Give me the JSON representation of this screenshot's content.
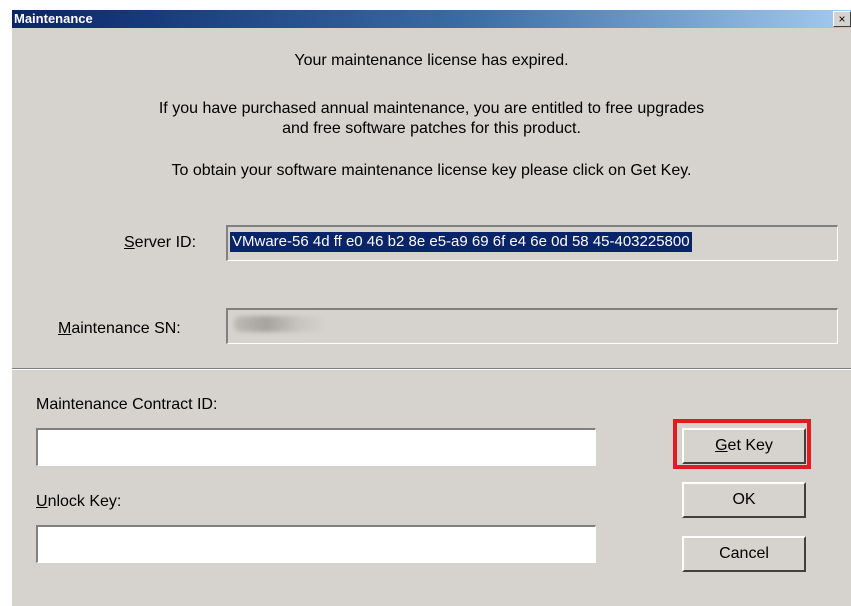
{
  "window": {
    "title": "Maintenance",
    "close_glyph": "×"
  },
  "message": {
    "line1": "Your maintenance license has expired.",
    "line2": "If you have purchased annual maintenance, you are entitled to free upgrades",
    "line3": "and free software patches for this product.",
    "line4": "To obtain your software maintenance license key please click on Get Key."
  },
  "server_id": {
    "label_accel": "S",
    "label_rest": "erver ID:",
    "value": "VMware-56 4d ff e0 46 b2 8e e5-a9 69 6f e4 6e 0d 58 45-403225800"
  },
  "maintenance_sn": {
    "label_accel": "M",
    "label_rest": "aintenance SN:"
  },
  "contract": {
    "label": "Maintenance Contract ID:",
    "value": ""
  },
  "unlock": {
    "label_accel": "U",
    "label_rest": "nlock Key:",
    "value": ""
  },
  "buttons": {
    "getkey_accel": "G",
    "getkey_rest": "et Key",
    "ok": "OK",
    "cancel": "Cancel"
  },
  "colors": {
    "highlight": "#e01b22",
    "title_bar": "#0a246a",
    "dialog_bg": "#d6d3ce"
  }
}
